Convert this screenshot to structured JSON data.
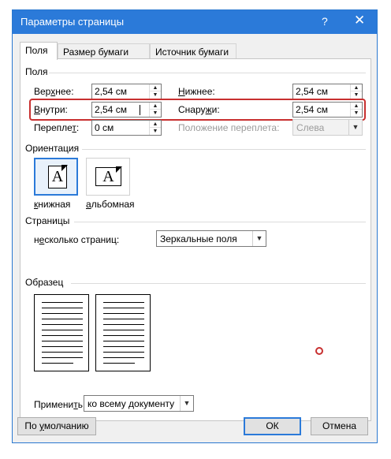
{
  "dialog": {
    "title": "Параметры страницы",
    "help_glyph": "?",
    "close_glyph": "✕"
  },
  "tabs": [
    {
      "label": "Поля",
      "active": true
    },
    {
      "label": "Размер бумаги",
      "active": false
    },
    {
      "label": "Источник бумаги",
      "active": false
    }
  ],
  "margins": {
    "section_title": "Поля",
    "top": {
      "label_pre": "Вер",
      "label_u": "х",
      "label_post": "нее:",
      "value": "2,54 см"
    },
    "bottom": {
      "label_pre": "",
      "label_u": "Н",
      "label_post": "ижнее:",
      "value": "2,54 см"
    },
    "inside": {
      "label_pre": "",
      "label_u": "В",
      "label_post": "нутри:",
      "value": "2,54 см"
    },
    "outside": {
      "label_pre": "Снару",
      "label_u": "ж",
      "label_post": "и:",
      "value": "2,54 см"
    },
    "gutter": {
      "label_pre": "Перепле",
      "label_u": "т",
      "label_post": ":",
      "value": "0 см"
    },
    "gutter_position": {
      "label": "Положение переплета:",
      "value": "Слева"
    }
  },
  "orientation": {
    "section_title": "Ориентация",
    "portrait": {
      "label_u": "к",
      "label_post": "нижная",
      "glyph": "A"
    },
    "landscape": {
      "label_u": "а",
      "label_post": "льбомная",
      "glyph": "A"
    }
  },
  "pages": {
    "section_title": "Страницы",
    "multiple_label_pre": "н",
    "multiple_label_u": "е",
    "multiple_label_post": "сколько страниц:",
    "multiple_value": "Зеркальные поля"
  },
  "preview": {
    "section_title": "Образец"
  },
  "apply": {
    "label_pre": "Примени",
    "label_u": "т",
    "label_post": "ь:",
    "value": "ко всему документу"
  },
  "buttons": {
    "default_pre": "По ",
    "default_u": "у",
    "default_post": "молчанию",
    "ok": "ОК",
    "cancel": "Отмена"
  },
  "spinner_glyphs": {
    "up": "▲",
    "down": "▼",
    "dropdown": "▼"
  },
  "colors": {
    "accent": "#2b7ad9",
    "highlight": "#c83030",
    "dialog_bg": "#f0f0f0"
  }
}
